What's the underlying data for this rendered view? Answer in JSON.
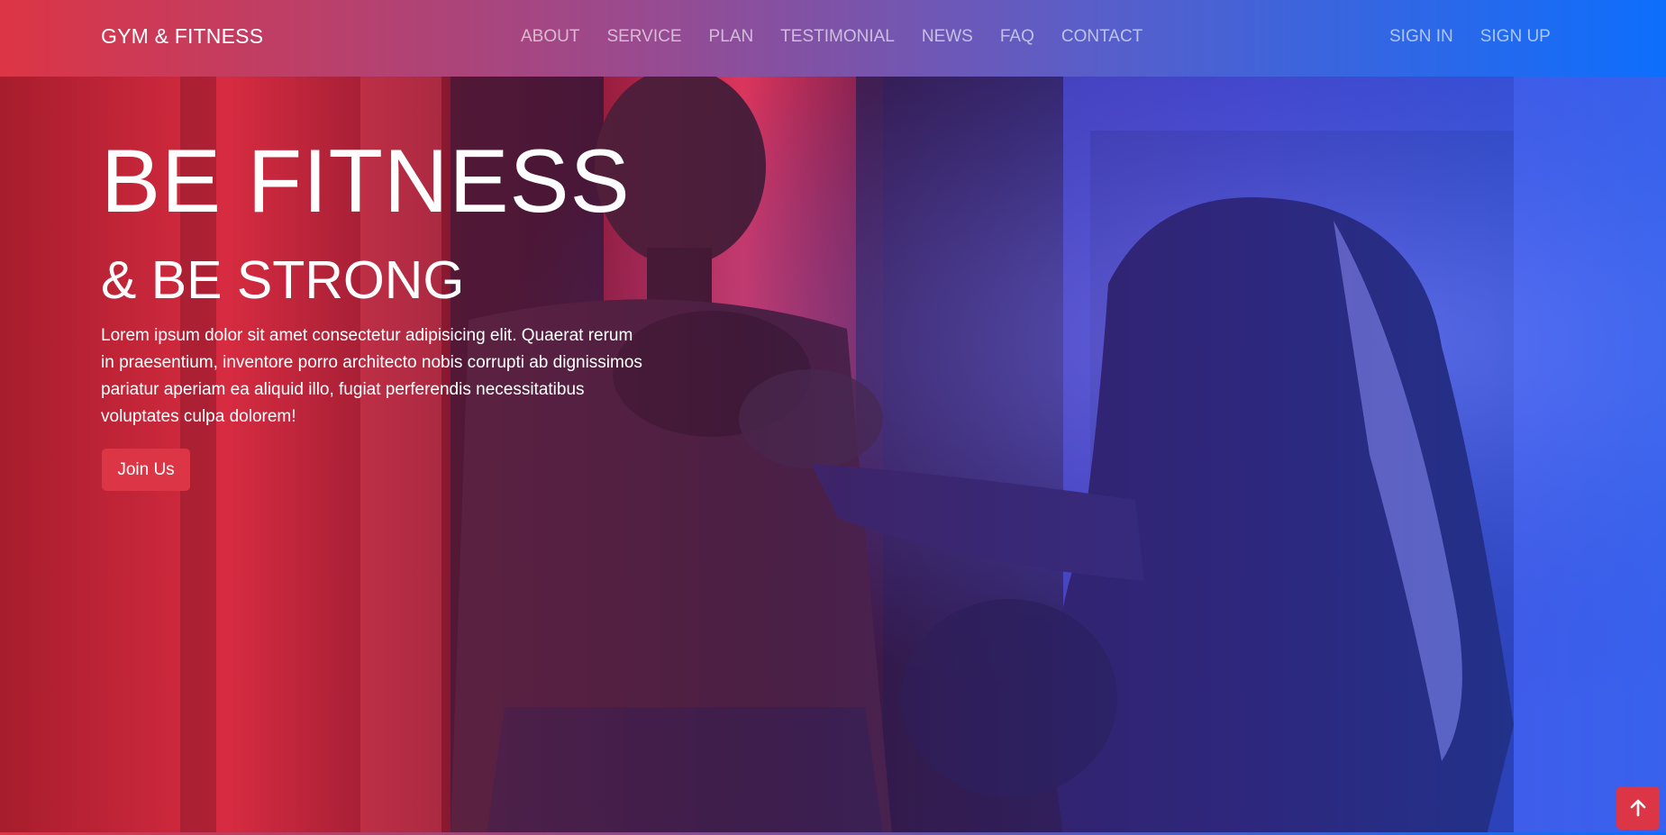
{
  "brand": "GYM & FITNESS",
  "nav": {
    "items": [
      "ABOUT",
      "SERVICE",
      "PLAN",
      "TESTIMONIAL",
      "NEWS",
      "FAQ",
      "CONTACT"
    ],
    "sign_in": "SIGN IN",
    "sign_up": "SIGN UP"
  },
  "hero": {
    "title": "BE FITNESS",
    "subtitle": "& BE STRONG",
    "text": "Lorem ipsum dolor sit amet consectetur adipisicing elit. Quaerat rerum in praesentium, inventore porro architecto nobis corrupti ab dignissimos pariatur aperiam ea aliquid illo, fugiat perferendis necessitatibus voluptates culpa dolorem!",
    "button": "Join Us"
  },
  "back_to_top_icon": "arrow-up-icon",
  "colors": {
    "primary_red": "#dc3545",
    "primary_blue": "#0d6efd"
  }
}
